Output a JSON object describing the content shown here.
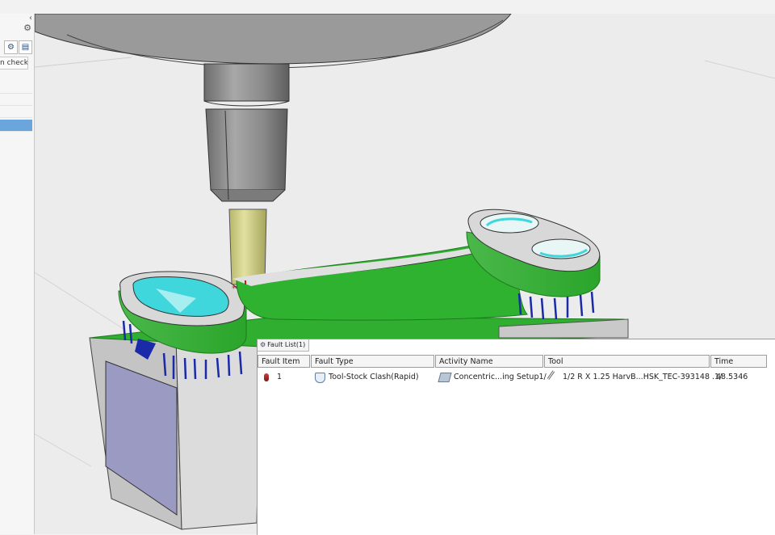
{
  "left_panel": {
    "collapse_glyph": "‹",
    "settings_glyph": "⚙",
    "tab_label": "n check"
  },
  "fault_list": {
    "tab_label": "Fault List(1)",
    "columns": [
      "Fault Item",
      "Fault Type",
      "Activity Name",
      "Tool",
      "Time"
    ],
    "rows": [
      {
        "item": "1",
        "type": "Tool-Stock Clash(Rapid)",
        "activity": "Concentric...ing Setup1/",
        "tool": "1/2 R X 1.25 HarvB...HSK_TEC-393148 .1/",
        "time": "48.5346"
      }
    ]
  },
  "colors": {
    "stock_green": "#2fb22f",
    "clash_cyan": "#3fd6dc",
    "tool_yellow": "#d6d58a",
    "holder_grey": "#8f8f8f",
    "selection_blue": "#6aa5dc"
  }
}
